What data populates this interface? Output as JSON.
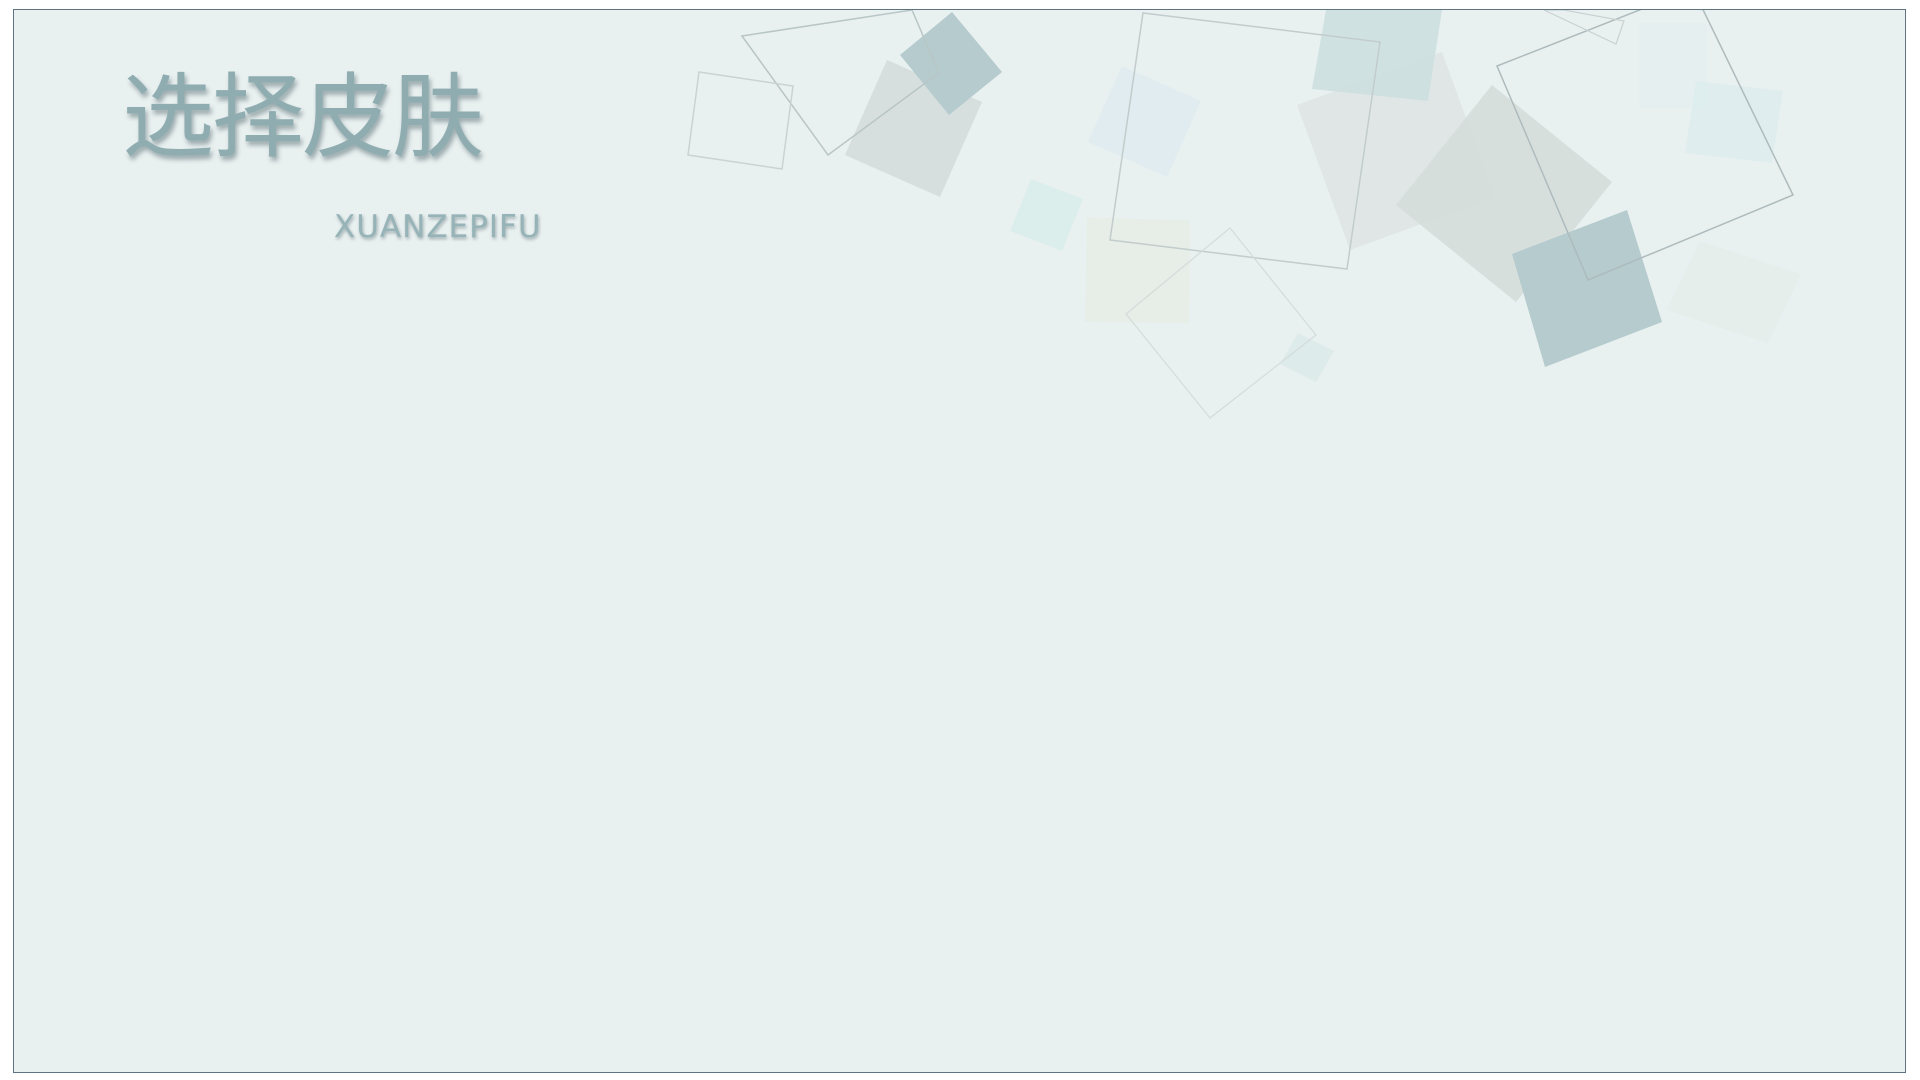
{
  "title": {
    "chinese": "选择皮肤",
    "pinyin": "XUANZEPIFU"
  },
  "colors": {
    "background": "#e9f0f0",
    "border": "#5f7382",
    "title_text": "#8fadb1",
    "accent_square": "#b5cbce"
  }
}
